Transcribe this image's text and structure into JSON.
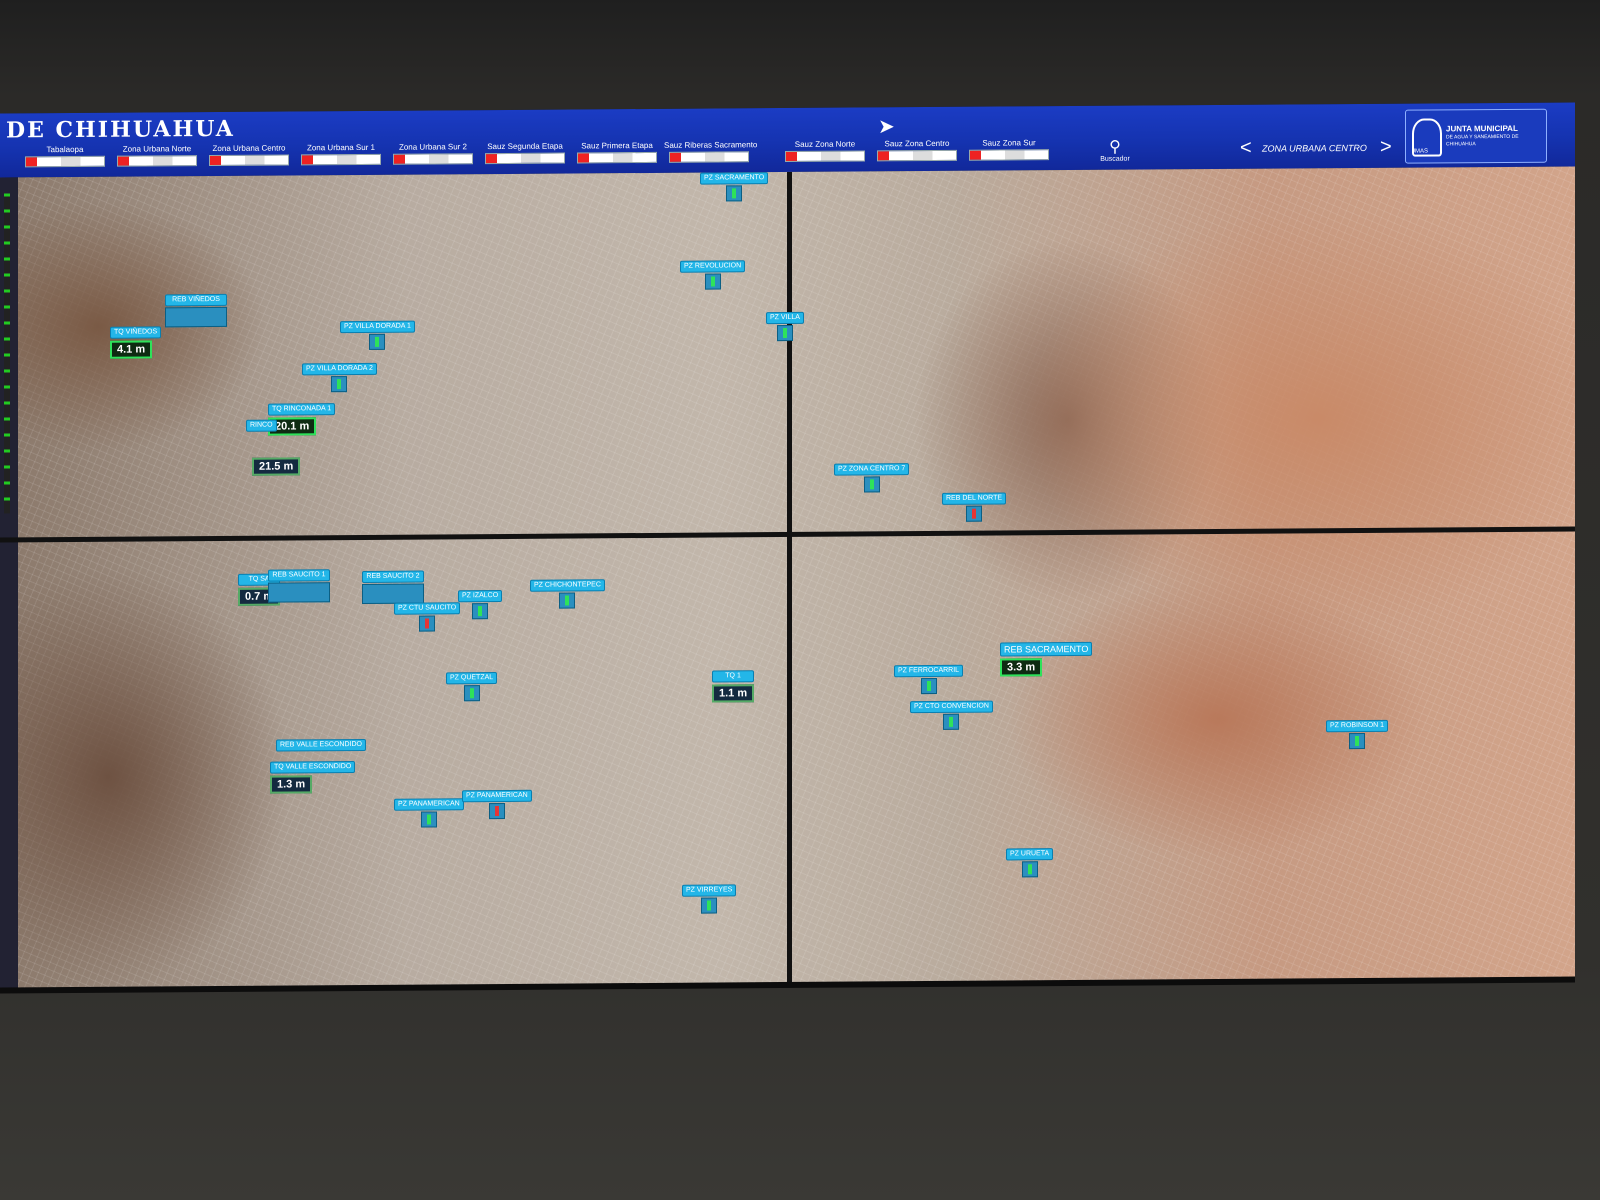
{
  "header": {
    "title": "DE CHIHUAHUA",
    "zones": [
      {
        "label": "Tabalaopa"
      },
      {
        "label": "Zona Urbana Norte"
      },
      {
        "label": "Zona Urbana Centro"
      },
      {
        "label": "Zona Urbana Sur 1"
      },
      {
        "label": "Zona Urbana Sur 2"
      },
      {
        "label": "Sauz Segunda Etapa"
      },
      {
        "label": "Sauz Primera Etapa"
      },
      {
        "label": "Sauz Riberas Sacramento"
      },
      {
        "label": "Sauz Zona Norte"
      },
      {
        "label": "Sauz Zona Centro"
      },
      {
        "label": "Sauz Zona Sur"
      }
    ],
    "search_label": "Buscador",
    "nav": {
      "prev": "<",
      "current": "ZONA URBANA CENTRO",
      "next": ">"
    },
    "logo": {
      "abbr": "JMAS",
      "name": "JUNTA MUNICIPAL",
      "sub": "DE AGUA Y SANEAMIENTO DE CHIHUAHUA"
    }
  },
  "stations": {
    "reb_vinedos": "REB VIÑEDOS",
    "tq_vinedos": "TQ VIÑEDOS",
    "tq_vinedos_val": "4.1 m",
    "pz_villa_dorada_1": "PZ VILLA DORADA 1",
    "pz_villa_dorada_2": "PZ VILLA DORADA 2",
    "tq_rinconada_1": "TQ RINCONADA 1",
    "rinco": "RINCO",
    "tq_rinconada_val": "20.1 m",
    "rinco_val": "21.5 m",
    "pz_sacramento": "PZ SACRAMENTO",
    "pz_revolucion": "PZ REVOLUCION",
    "pz_villa": "PZ VILLA",
    "pz_zona_centro_7": "PZ ZONA CENTRO 7",
    "reb_del_norte": "REB DEL NORTE",
    "tq_sa": "TQ SA",
    "tq_sa_val": "0.7 m",
    "reb_saucito_1": "REB SAUCITO 1",
    "reb_saucito_2": "REB SAUCITO 2",
    "pz_ctu_saucito": "PZ CTU SAUCITO",
    "pz_izalco": "PZ IZALCO",
    "pz_chichontepec": "PZ CHICHONTEPEC",
    "pz_quetzal": "PZ QUETZAL",
    "tq_1": "TQ 1",
    "tq_1_val": "1.1 m",
    "reb_valle_escondido": "REB VALLE ESCONDIDO",
    "tq_valle_escondido": "TQ VALLE ESCONDIDO",
    "tq_valle_escondido_val": "1.3 m",
    "pz_panamerican_1": "PZ PANAMERICAN",
    "pz_panamerican_2": "PZ PANAMERICAN",
    "pz_virreyes": "PZ VIRREYES",
    "pz_ferrocarril": "PZ FERROCARRIL",
    "pz_cto_convencion": "PZ CTO CONVENCION",
    "reb_sacramento": "REB SACRAMENTO",
    "reb_sacramento_val": "3.3 m",
    "pz_robinson_1": "PZ ROBINSON 1",
    "pz_urueta": "PZ URUETA"
  }
}
